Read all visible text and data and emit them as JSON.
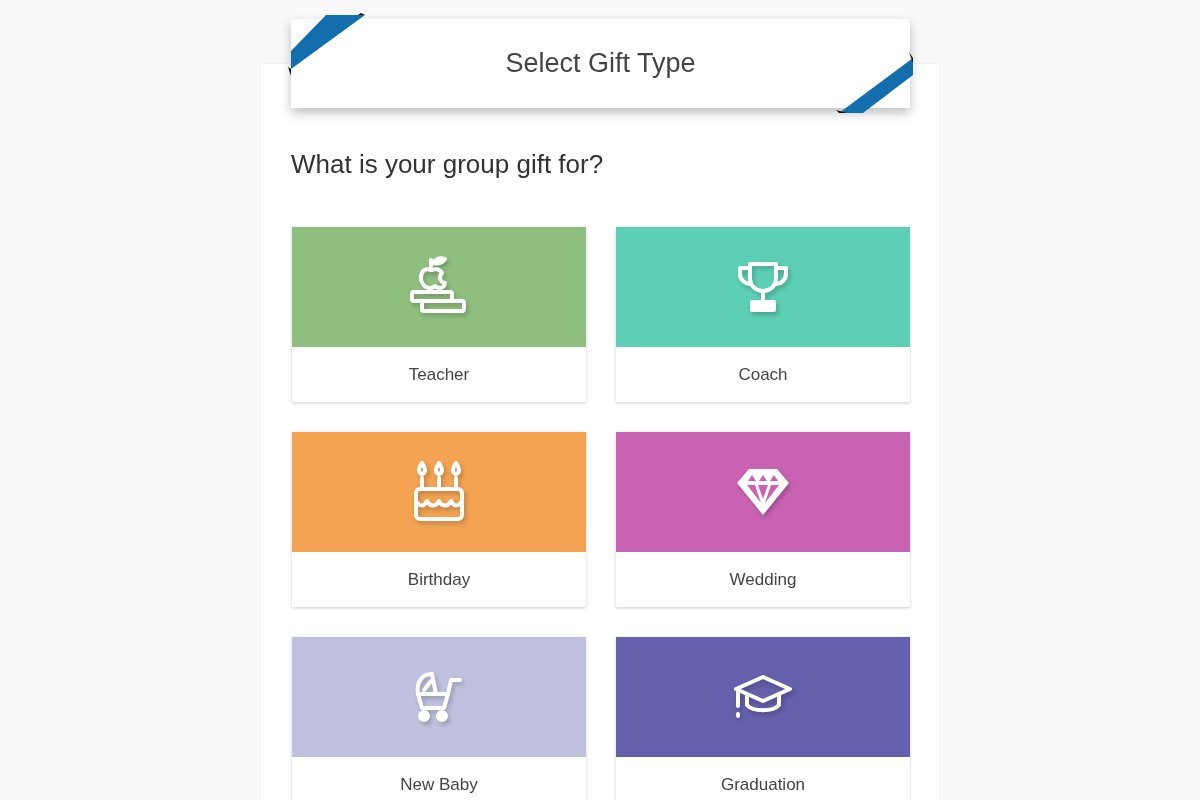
{
  "header": {
    "title": "Select Gift Type"
  },
  "question": "What is your group gift for?",
  "gift_types": [
    {
      "label": "Teacher",
      "color": "#8fbf7f",
      "kind": "apple-books"
    },
    {
      "label": "Coach",
      "color": "#5ccfb4",
      "kind": "trophy"
    },
    {
      "label": "Birthday",
      "color": "#f3a352",
      "kind": "cake"
    },
    {
      "label": "Wedding",
      "color": "#c962b3",
      "kind": "diamond"
    },
    {
      "label": "New Baby",
      "color": "#c0c1de",
      "kind": "stroller"
    },
    {
      "label": "Graduation",
      "color": "#6560ab",
      "kind": "cap"
    }
  ]
}
